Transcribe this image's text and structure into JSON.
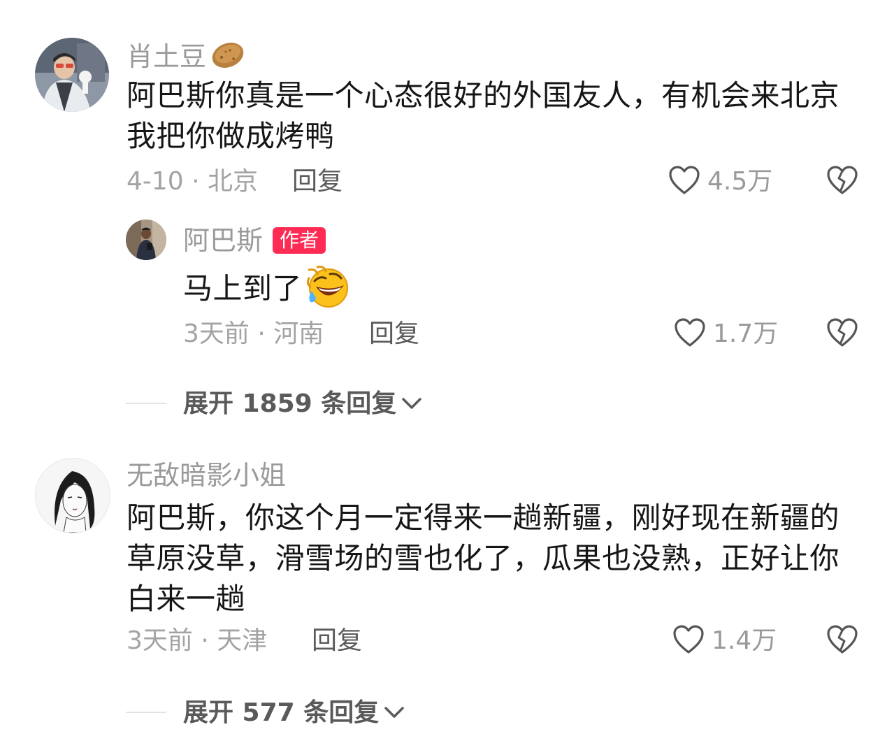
{
  "comments": [
    {
      "username": "肖土豆",
      "text": "阿巴斯你真是一个心态很好的外国友人，有机会来北京我把你做成烤鸭",
      "meta": "4-10 · 北京",
      "reply_label": "回复",
      "likes": "4.5万",
      "username_emoji": "potato-icon",
      "reply": {
        "username": "阿巴斯",
        "badge": "作者",
        "text": "马上到了",
        "emoji": "rolling-laughing-emoji",
        "meta": "3天前 · 河南",
        "reply_label": "回复",
        "likes": "1.7万"
      },
      "expand_label": "展开 1859 条回复"
    },
    {
      "username": "无敌暗影小姐",
      "text": "阿巴斯，你这个月一定得来一趟新疆，刚好现在新疆的草原没草，滑雪场的雪也化了，瓜果也没熟，正好让你白来一趟",
      "meta": "3天前 · 天津",
      "reply_label": "回复",
      "likes": "1.4万",
      "expand_label": "展开 577 条回复"
    }
  ],
  "colors": {
    "badge": "#fe2c55",
    "muted": "#a3a3a3",
    "text": "#161616"
  }
}
